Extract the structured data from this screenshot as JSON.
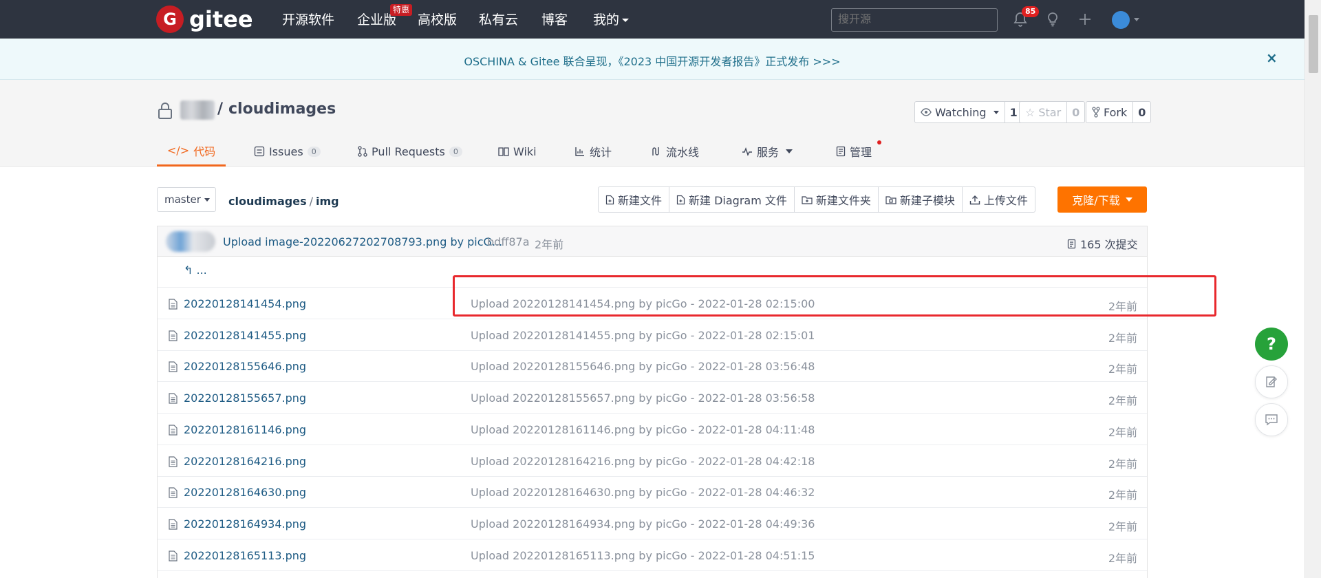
{
  "navbar": {
    "logo_mark": "G",
    "logo_text": "gitee",
    "items": [
      {
        "label": "开源软件"
      },
      {
        "label": "企业版"
      },
      {
        "label": "高校版"
      },
      {
        "label": "私有云"
      },
      {
        "label": "博客"
      },
      {
        "label": "我的"
      }
    ],
    "enterprise_badge": "特惠",
    "search_placeholder": "搜开源",
    "notification_count": "85"
  },
  "banner": {
    "text": "OSCHINA & Gitee 联合呈现，《2023 中国开源开发者报告》正式发布 >>>",
    "close": "×"
  },
  "repo": {
    "separator": "/",
    "name": "cloudimages",
    "watch": {
      "label": "Watching",
      "count": "1"
    },
    "star": {
      "label": "Star",
      "count": "0"
    },
    "fork": {
      "label": "Fork",
      "count": "0"
    }
  },
  "tabs": [
    {
      "label": "代码",
      "icon": "code-icon"
    },
    {
      "label": "Issues",
      "count": "0",
      "icon": "issues-icon"
    },
    {
      "label": "Pull Requests",
      "count": "0",
      "icon": "pull-request-icon"
    },
    {
      "label": "Wiki",
      "icon": "wiki-icon"
    },
    {
      "label": "统计",
      "icon": "stats-icon"
    },
    {
      "label": "流水线",
      "icon": "pipeline-icon"
    },
    {
      "label": "服务",
      "icon": "service-icon"
    },
    {
      "label": "管理",
      "icon": "manage-icon"
    }
  ],
  "branch": {
    "label": "master"
  },
  "path": {
    "root": "cloudimages",
    "sep": "/",
    "dir": "img"
  },
  "toolbar": {
    "new_file": "新建文件",
    "new_diagram": "新建 Diagram 文件",
    "new_folder": "新建文件夹",
    "new_submodule": "新建子模块",
    "upload": "上传文件",
    "clone": "克隆/下载"
  },
  "last_commit": {
    "message": "Upload image-20220627202708793.png by picG...",
    "hash": "bdff87a",
    "time": "2年前",
    "count_label": "165 次提交"
  },
  "back_label": "...",
  "files": [
    {
      "name": "20220128141454.png",
      "message": "Upload 20220128141454.png by picGo - 2022-01-28 02:15:00",
      "time": "2年前"
    },
    {
      "name": "20220128141455.png",
      "message": "Upload 20220128141455.png by picGo - 2022-01-28 02:15:01",
      "time": "2年前"
    },
    {
      "name": "20220128155646.png",
      "message": "Upload 20220128155646.png by picGo - 2022-01-28 03:56:48",
      "time": "2年前"
    },
    {
      "name": "20220128155657.png",
      "message": "Upload 20220128155657.png by picGo - 2022-01-28 03:56:58",
      "time": "2年前"
    },
    {
      "name": "20220128161146.png",
      "message": "Upload 20220128161146.png by picGo - 2022-01-28 04:11:48",
      "time": "2年前"
    },
    {
      "name": "20220128164216.png",
      "message": "Upload 20220128164216.png by picGo - 2022-01-28 04:42:18",
      "time": "2年前"
    },
    {
      "name": "20220128164630.png",
      "message": "Upload 20220128164630.png by picGo - 2022-01-28 04:46:32",
      "time": "2年前"
    },
    {
      "name": "20220128164934.png",
      "message": "Upload 20220128164934.png by picGo - 2022-01-28 04:49:36",
      "time": "2年前"
    },
    {
      "name": "20220128165113.png",
      "message": "Upload 20220128165113.png by picGo - 2022-01-28 04:51:15",
      "time": "2年前"
    }
  ],
  "float": {
    "help": "?"
  },
  "colors": {
    "navbar_bg": "#2e3440",
    "brand_red": "#c71d23",
    "accent_orange": "#fe7300",
    "active_tab": "#f1671d",
    "link_blue": "#1e5b84",
    "highlight_red": "#e8282d",
    "help_green": "#27a23a"
  }
}
